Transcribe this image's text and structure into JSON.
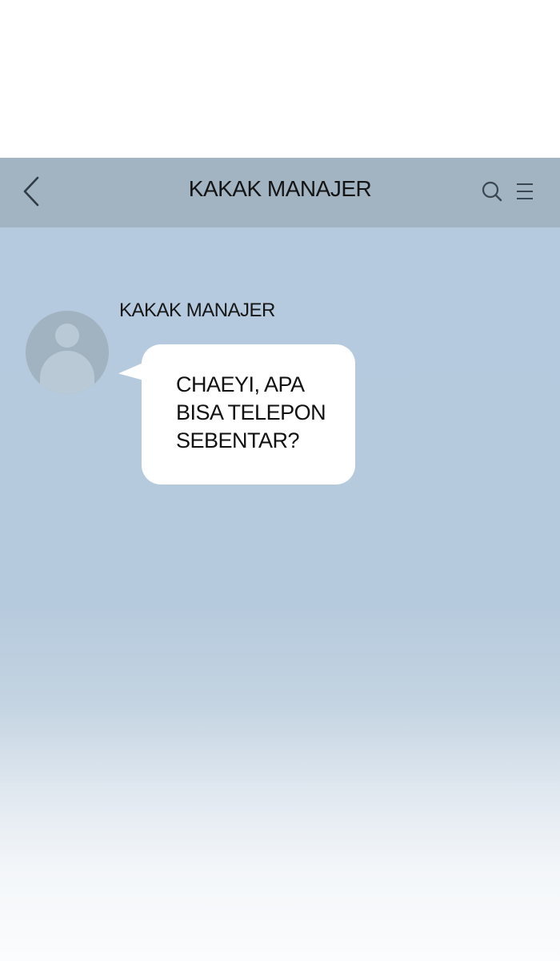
{
  "header": {
    "title": "KAKAK MANAJER",
    "back_icon": "chevron-left-icon",
    "search_icon": "search-icon",
    "menu_icon": "menu-icon"
  },
  "chat": {
    "messages": [
      {
        "sender": "KAKAK MANAJER",
        "avatar_icon": "default-avatar-icon",
        "text": "CHAEYI, APA\nBISA TELEPON\nSEBENTAR?"
      }
    ]
  },
  "colors": {
    "header_bg": "#a2b3c2",
    "chat_bg": "#b5cadf",
    "bubble_bg": "#ffffff",
    "avatar_bg": "#a1b2c1",
    "text": "#141414"
  }
}
